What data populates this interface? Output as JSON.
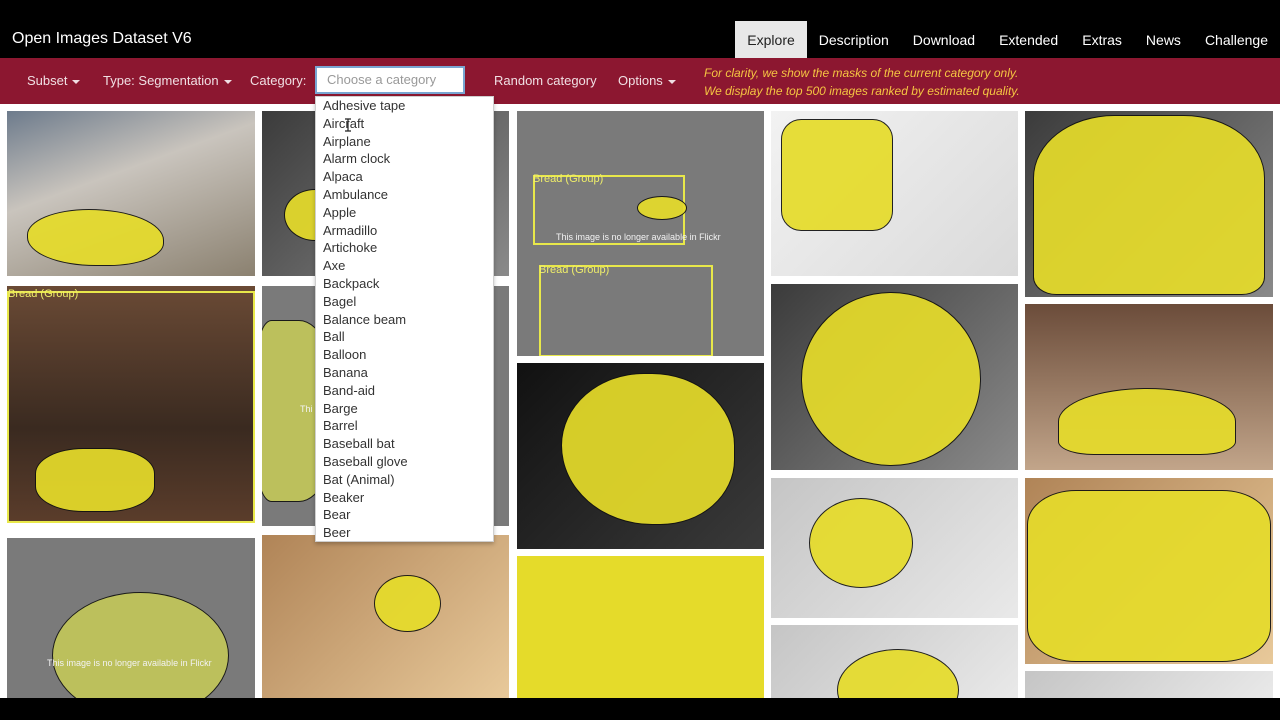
{
  "app": {
    "title": "Open Images Dataset V6"
  },
  "nav": {
    "tabs": [
      {
        "label": "Explore",
        "active": true
      },
      {
        "label": "Description",
        "active": false
      },
      {
        "label": "Download",
        "active": false
      },
      {
        "label": "Extended",
        "active": false
      },
      {
        "label": "Extras",
        "active": false
      },
      {
        "label": "News",
        "active": false
      },
      {
        "label": "Challenge",
        "active": false
      }
    ]
  },
  "filters": {
    "subset_label": "Subset",
    "type_label": "Type: Segmentation",
    "category_label": "Category:",
    "category_placeholder": "Choose a category",
    "random_label": "Random category",
    "options_label": "Options"
  },
  "notice": {
    "line1": "For clarity, we show the masks of the current category only.",
    "line2": "We display the top 500 images ranked by estimated quality."
  },
  "grid": {
    "bbox_label": "Bread (Group)",
    "unavailable_text": "This image is no longer available in Flickr",
    "unavailable_partial": "Thi"
  },
  "dropdown": {
    "options": [
      "Adhesive tape",
      "Aircraft",
      "Airplane",
      "Alarm clock",
      "Alpaca",
      "Ambulance",
      "Apple",
      "Armadillo",
      "Artichoke",
      "Axe",
      "Backpack",
      "Bagel",
      "Balance beam",
      "Ball",
      "Balloon",
      "Banana",
      "Band-aid",
      "Barge",
      "Barrel",
      "Baseball bat",
      "Baseball glove",
      "Bat (Animal)",
      "Beaker",
      "Bear",
      "Beer"
    ]
  },
  "colors": {
    "header_bg": "#000000",
    "filter_bg": "#8c1730",
    "notice": "#f5c542",
    "mask": "#e6dc2a",
    "bbox": "#e8e84a"
  },
  "icons": {
    "caret": "caret-down-icon",
    "cursor": "text-cursor-icon"
  }
}
